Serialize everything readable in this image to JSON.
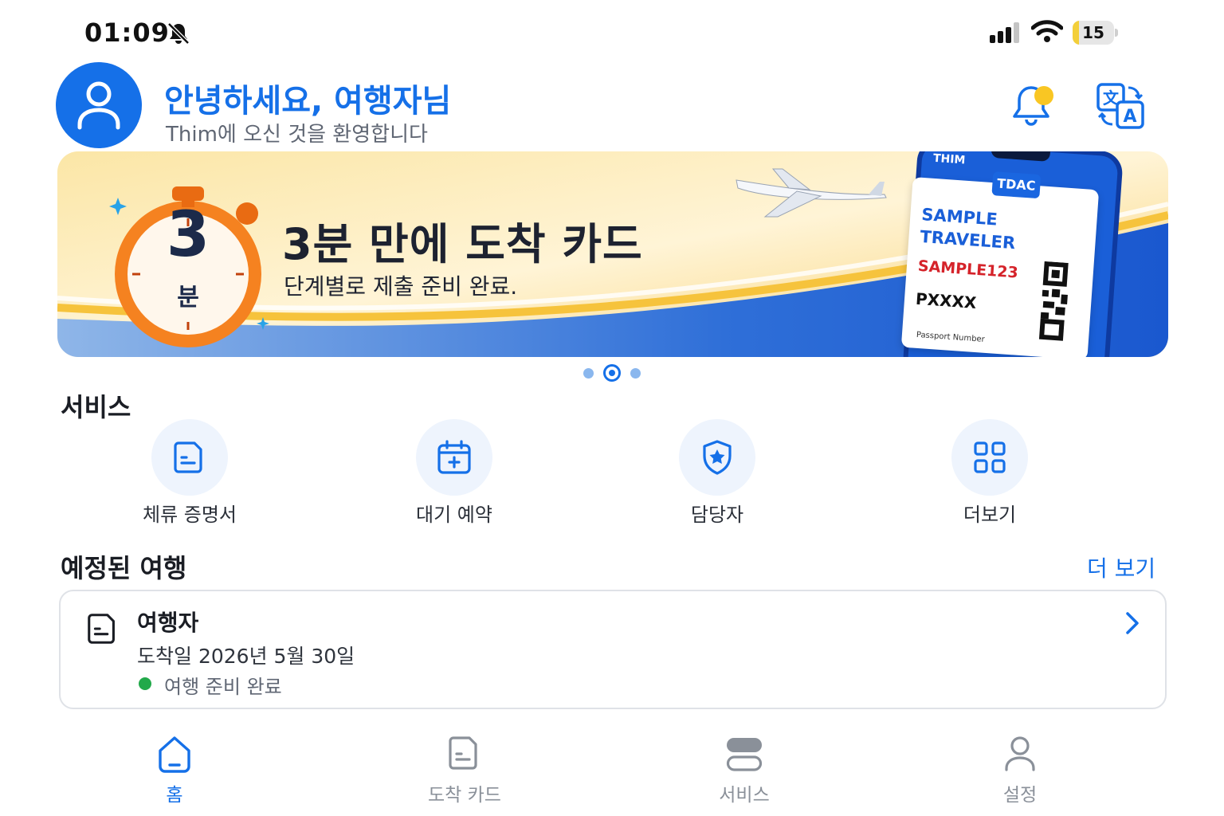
{
  "status_bar": {
    "time": "01:09",
    "battery": "15",
    "battery_level_percent": 15
  },
  "header": {
    "greeting": "안녕하세요, 여행자님",
    "subtitle": "Thim에 오신 것을 환영합니다"
  },
  "banner": {
    "title": "3분 만에 도착 카드",
    "subtitle": "단계별로 제출 준비 완료.",
    "timer_number": "3",
    "timer_unit": "분",
    "phone_app": "THIM",
    "card_tab": "TDAC",
    "card_name": "SAMPLE TRAVELER",
    "card_id": "SAMPLE123",
    "card_passport": "PXXXX",
    "card_passport_label": "Passport Number",
    "page_count": 3,
    "active_page": 2
  },
  "services": {
    "title": "서비스",
    "items": [
      {
        "label": "체류 증명서",
        "icon": "document-icon"
      },
      {
        "label": "대기 예약",
        "icon": "calendar-plus-icon"
      },
      {
        "label": "담당자",
        "icon": "shield-star-icon"
      },
      {
        "label": "더보기",
        "icon": "grid-icon"
      }
    ]
  },
  "trips": {
    "title": "예정된 여행",
    "more": "더 보기",
    "items": [
      {
        "name": "여행자",
        "date": "도착일 2026년 5월 30일",
        "status": "여행 준비 완료"
      }
    ]
  },
  "tabs": [
    {
      "label": "홈",
      "icon": "home-icon",
      "active": true
    },
    {
      "label": "도착 카드",
      "icon": "document-icon",
      "active": false
    },
    {
      "label": "서비스",
      "icon": "services-icon",
      "active": false
    },
    {
      "label": "설정",
      "icon": "person-icon",
      "active": false
    }
  ],
  "colors": {
    "accent": "#1570e8",
    "status_green": "#22a94a",
    "notification_dot": "#f9c623"
  }
}
